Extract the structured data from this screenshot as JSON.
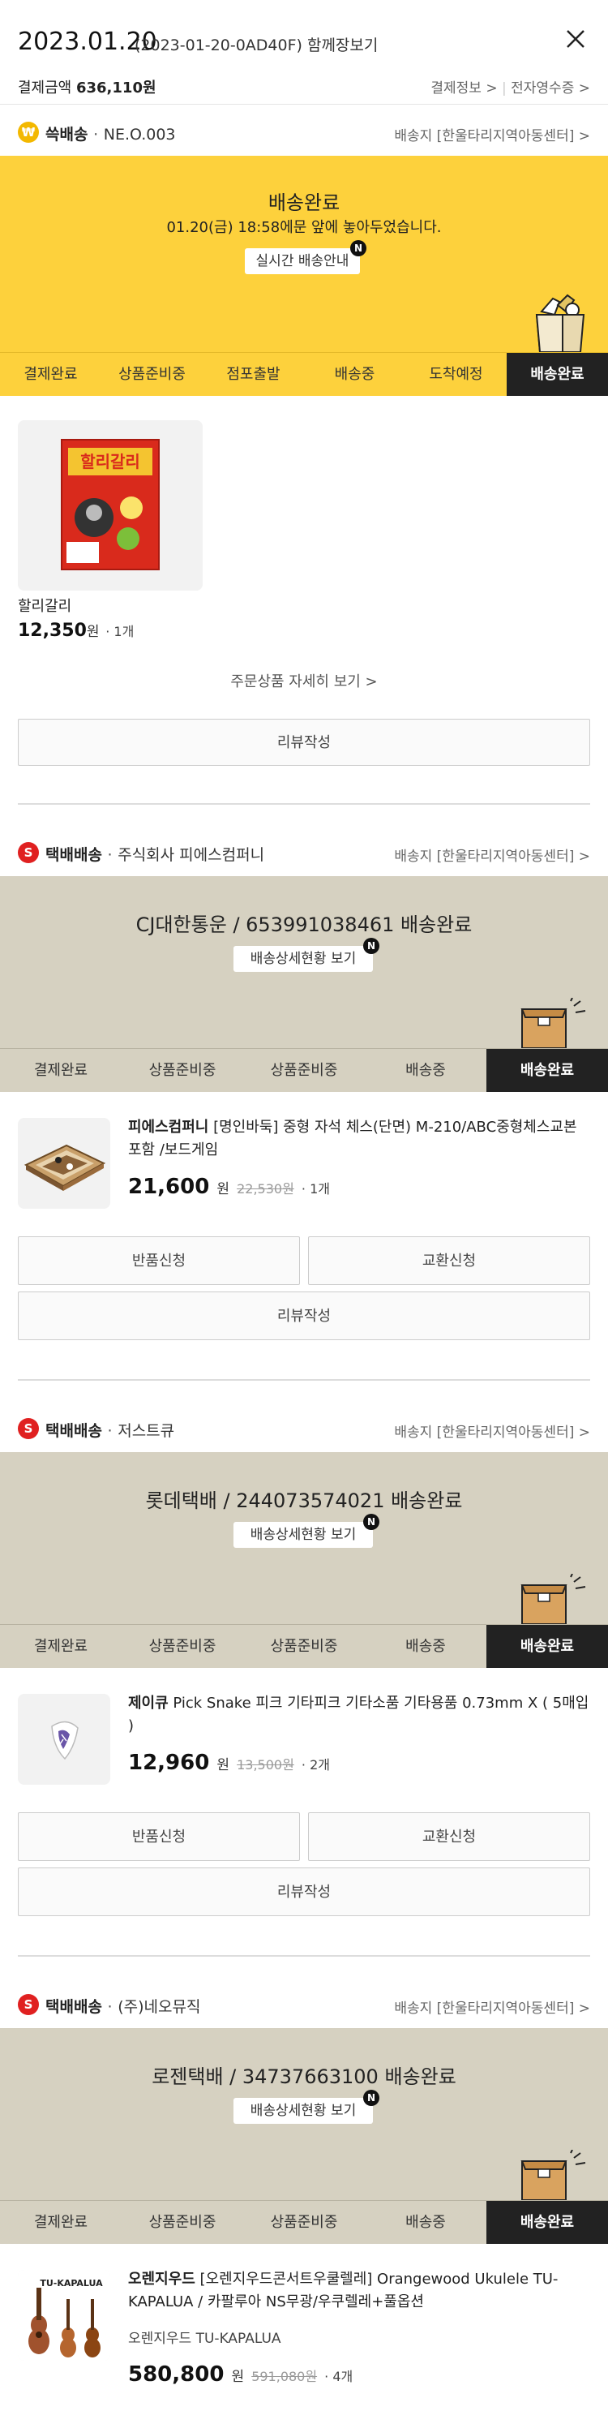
{
  "header": {
    "date": "2023.01.20",
    "order_code": "(2023-01-20-0AD40F)",
    "group_view": "함께장보기",
    "amount_label": "결제금액",
    "amount_value": "636,110원",
    "pay_info": "결제정보 >",
    "receipt": "전자영수증 >"
  },
  "colors": {
    "yellow": "#fdd13c",
    "beige": "#d6d1c1",
    "dark": "#222222",
    "red": "#e02020"
  },
  "shipments": [
    {
      "badge": "₩",
      "type": "쓱배송",
      "dot": "·",
      "name": "NE.O.003",
      "destination": "배송지 [한울타리지역아동센터] >",
      "banner_title": "배송완료",
      "banner_sub": "01.20(금) 18:58에문 앞에 놓아두었습니다.",
      "banner_button": "실시간 배송안내",
      "new_badge": "N",
      "steps": [
        "결제완료",
        "상품준비중",
        "점포출발",
        "배송중",
        "도착예정",
        "배송완료"
      ],
      "product": {
        "name": "할리갈리",
        "price": "12,350",
        "won": "원",
        "qty": "· 1개",
        "box_label": "할리갈리"
      },
      "detail_link": "주문상품 자세히 보기 >",
      "review": "리뷰작성"
    },
    {
      "badge": "S",
      "type": "택배배송",
      "dot": "·",
      "name": "주식회사 피에스컴퍼니",
      "destination": "배송지 [한울타리지역아동센터] >",
      "banner_title": "CJ대한통운 / 653991038461 배송완료",
      "banner_button": "배송상세현황 보기",
      "new_badge": "N",
      "steps": [
        "결제완료",
        "상품준비중",
        "상품준비중",
        "배송중",
        "배송완료"
      ],
      "product": {
        "brand": "피에스컴퍼니",
        "name": "[명인바둑] 중형 자석 체스(단면) M-210/ABC중형체스교본 포함 /보드게임",
        "price": "21,600",
        "won": "원",
        "orig": "22,530원",
        "qty": "· 1개"
      },
      "return": "반품신청",
      "exchange": "교환신청",
      "review": "리뷰작성"
    },
    {
      "badge": "S",
      "type": "택배배송",
      "dot": "·",
      "name": "저스트큐",
      "destination": "배송지 [한울타리지역아동센터] >",
      "banner_title": "롯데택배 / 244073574021 배송완료",
      "banner_button": "배송상세현황 보기",
      "new_badge": "N",
      "steps": [
        "결제완료",
        "상품준비중",
        "상품준비중",
        "배송중",
        "배송완료"
      ],
      "product": {
        "brand": "제이큐",
        "name": "Pick Snake 피크 기타피크 기타소품 기타용품 0.73mm X ( 5매입 )",
        "price": "12,960",
        "won": "원",
        "orig": "13,500원",
        "qty": "· 2개"
      },
      "return": "반품신청",
      "exchange": "교환신청",
      "review": "리뷰작성"
    },
    {
      "badge": "S",
      "type": "택배배송",
      "dot": "·",
      "name": "(주)네오뮤직",
      "destination": "배송지 [한울타리지역아동센터] >",
      "banner_title": "로젠택배 / 34737663100 배송완료",
      "banner_button": "배송상세현황 보기",
      "new_badge": "N",
      "steps": [
        "결제완료",
        "상품준비중",
        "상품준비중",
        "배송중",
        "배송완료"
      ],
      "product": {
        "brand": "오렌지우드",
        "name": "[오렌지우드콘서트우쿨렐레] Orangewood Ukulele TU-KAPALUA / 카팔루아 NS무광/우쿠렐레+풀옵션",
        "option": "오렌지우드 TU-KAPALUA",
        "price": "580,800",
        "won": "원",
        "orig": "591,080원",
        "qty": "· 4개",
        "box_label": "TU-KAPALUA"
      }
    }
  ]
}
